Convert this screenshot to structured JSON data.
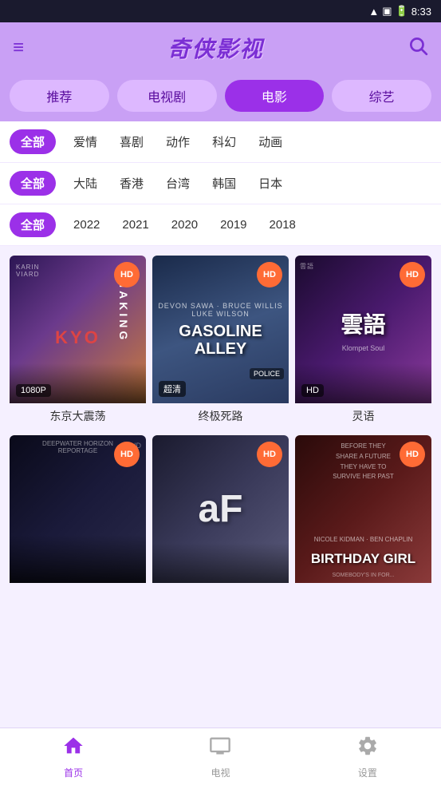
{
  "statusBar": {
    "time": "8:33"
  },
  "header": {
    "title": "奇侠影视",
    "menuIcon": "≡",
    "searchIcon": "🔍"
  },
  "navTabs": [
    {
      "id": "recommend",
      "label": "推荐",
      "active": false
    },
    {
      "id": "tv",
      "label": "电视剧",
      "active": false
    },
    {
      "id": "movie",
      "label": "电影",
      "active": true
    },
    {
      "id": "variety",
      "label": "综艺",
      "active": false
    }
  ],
  "filters": [
    {
      "id": "genre",
      "options": [
        "全部",
        "爱情",
        "喜剧",
        "动作",
        "科幻",
        "动画"
      ],
      "activeIndex": 0
    },
    {
      "id": "region",
      "options": [
        "全部",
        "大陆",
        "香港",
        "台湾",
        "韩国",
        "日本"
      ],
      "activeIndex": 0
    },
    {
      "id": "year",
      "options": [
        "全部",
        "2022",
        "2021",
        "2020",
        "2019",
        "2018"
      ],
      "activeIndex": 0
    }
  ],
  "movies": [
    {
      "id": 1,
      "title": "东京大震荡",
      "quality": "1080P",
      "badge": "HD",
      "posterClass": "poster-1",
      "posterMain": "KYO\nHAKING",
      "posterSub": "KARIN VIARD"
    },
    {
      "id": 2,
      "title": "终极死路",
      "quality": "超清",
      "badge": "HD",
      "posterClass": "poster-2",
      "posterMain": "GASOLINE\nALLEY",
      "posterSub": "BRUCE WILLIS"
    },
    {
      "id": 3,
      "title": "灵语",
      "quality": "HD",
      "badge": "HD",
      "posterClass": "poster-3",
      "posterMain": "灵语",
      "posterSub": "Klompet Soul"
    },
    {
      "id": 4,
      "title": "",
      "quality": "",
      "badge": "HD",
      "posterClass": "poster-4",
      "posterMain": "",
      "posterSub": "DEEPWATER HORIZON"
    },
    {
      "id": 5,
      "title": "",
      "quality": "",
      "badge": "HD",
      "posterClass": "poster-5",
      "posterMain": "aF",
      "posterSub": ""
    },
    {
      "id": 6,
      "title": "",
      "quality": "",
      "badge": "HD",
      "posterClass": "poster-6",
      "posterMain": "BIRTHDAY GIRL",
      "posterSub": "NICOLE KIDMAN · BEN CHAPLIN"
    }
  ],
  "bottomNav": [
    {
      "id": "home",
      "label": "首页",
      "icon": "🏠",
      "active": true
    },
    {
      "id": "tv",
      "label": "电视",
      "icon": "📺",
      "active": false
    },
    {
      "id": "settings",
      "label": "设置",
      "icon": "⚙️",
      "active": false
    }
  ]
}
